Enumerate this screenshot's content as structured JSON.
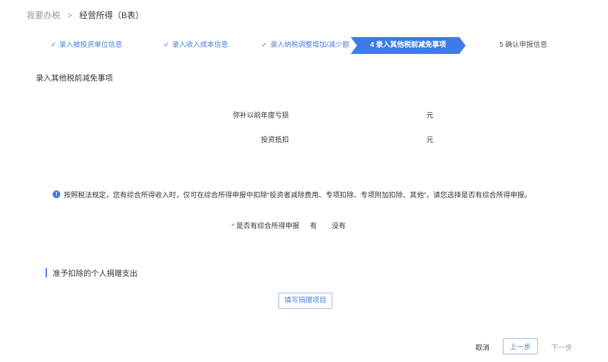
{
  "breadcrumb": {
    "home": "我要办税",
    "separator": ">",
    "current": "经营所得（B表）"
  },
  "steps": [
    {
      "label": "录入被投资单位信息",
      "done": true
    },
    {
      "label": "录入收入成本信息",
      "done": true
    },
    {
      "label": "录入纳税调整增加/减少额",
      "done": true
    },
    {
      "label": "4 录入其他税前减免事项",
      "done": false,
      "active": true
    },
    {
      "label": "5 确认申报信息",
      "done": false
    }
  ],
  "check_mark": "✓",
  "section": {
    "title": "录入其他税前减免事项"
  },
  "form": {
    "loss_label": "弥补以前年度亏损",
    "loss_unit": "元",
    "invest_label": "投资抵扣",
    "invest_unit": "元"
  },
  "notice": {
    "icon": "!",
    "text": "按照税法规定，您有综合所得收入时，仅可在综合所得申报中扣除“投资者减除费用、专项扣除、专项附加扣除、其他”，请您选择是否有综合所得申报。"
  },
  "radio": {
    "required_mark": "*",
    "label": "是否有综合所得申报",
    "option_yes": "有",
    "option_no": "没有"
  },
  "donation": {
    "title": "准予扣除的个人捐赠支出",
    "fill_button": "填写捐赠项目"
  },
  "footer": {
    "cancel": "取消",
    "prev": "上一步",
    "next": "下一步"
  },
  "colors": {
    "accent": "#3d7be6",
    "link": "#4a7fd9"
  }
}
